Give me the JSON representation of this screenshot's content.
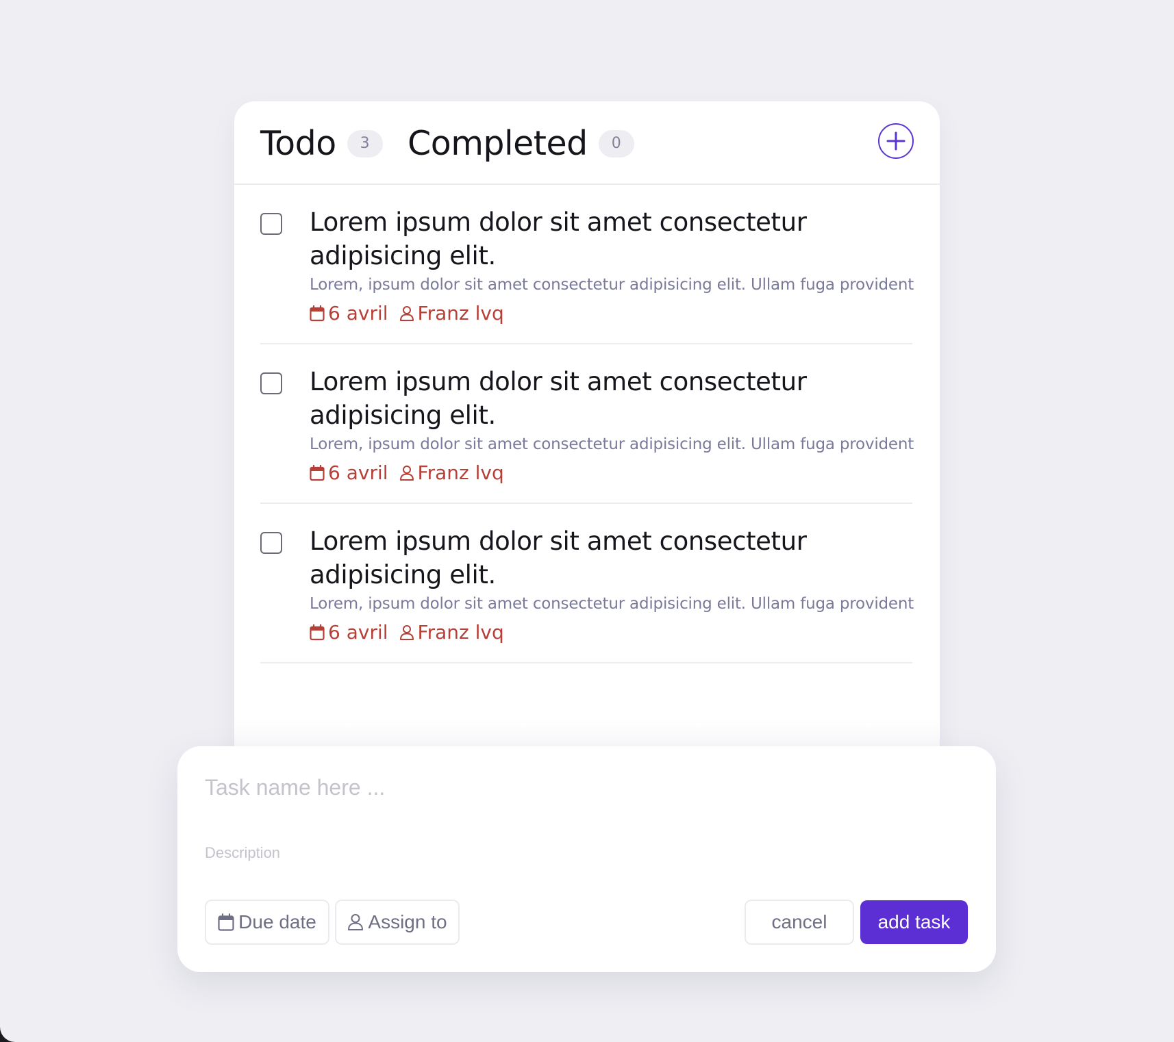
{
  "header": {
    "tabs": [
      {
        "label": "Todo",
        "count": "3"
      },
      {
        "label": "Completed",
        "count": "0"
      }
    ],
    "add_icon": "plus-circle-icon"
  },
  "tasks": [
    {
      "title": "Lorem ipsum dolor sit amet consectetur adipisicing elit.",
      "description": "Lorem, ipsum dolor sit amet consectetur adipisicing elit. Ullam fuga provident",
      "due": "6 avril",
      "assignee": "Franz lvq",
      "checked": false
    },
    {
      "title": "Lorem ipsum dolor sit amet consectetur adipisicing elit.",
      "description": "Lorem, ipsum dolor sit amet consectetur adipisicing elit. Ullam fuga provident",
      "due": "6 avril",
      "assignee": "Franz lvq",
      "checked": false
    },
    {
      "title": "Lorem ipsum dolor sit amet consectetur adipisicing elit.",
      "description": "Lorem, ipsum dolor sit amet consectetur adipisicing elit. Ullam fuga provident",
      "due": "6 avril",
      "assignee": "Franz lvq",
      "checked": false
    }
  ],
  "new_task": {
    "name_placeholder": "Task name here ...",
    "name_value": "",
    "description_placeholder": "Description",
    "description_value": "",
    "due_date_label": "Due date",
    "assign_label": "Assign to",
    "cancel_label": "cancel",
    "add_label": "add task"
  },
  "colors": {
    "background": "#eeeef3",
    "accent": "#5b2fd3",
    "meta": "#b64038",
    "muted": "#7a7a9a"
  }
}
